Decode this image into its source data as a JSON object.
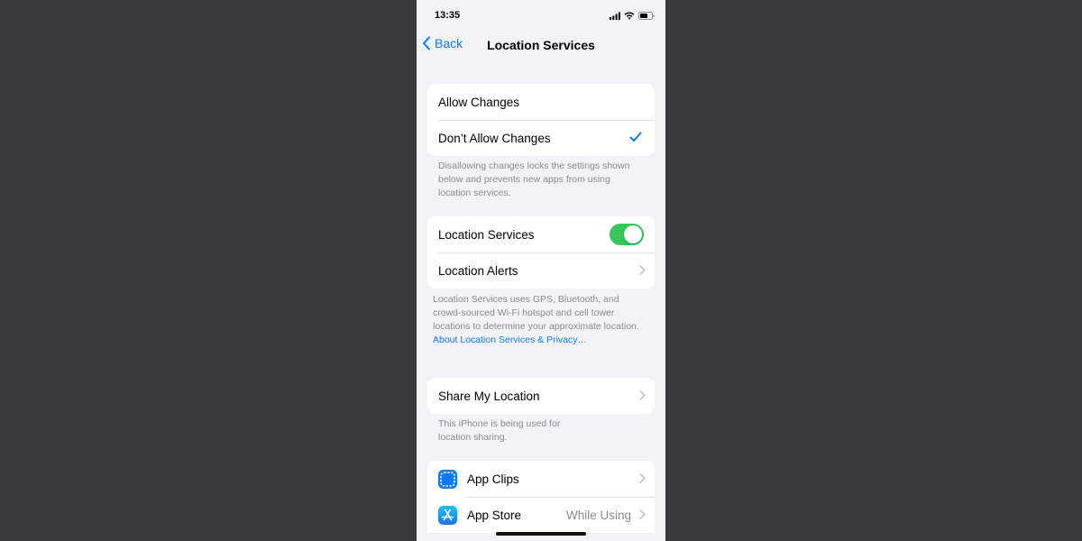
{
  "status_bar": {
    "time": "13:35"
  },
  "nav": {
    "back_label": "Back",
    "title": "Location Services"
  },
  "changes_group": {
    "items": [
      {
        "label": "Allow Changes",
        "selected": false
      },
      {
        "label": "Don’t Allow Changes",
        "selected": true
      }
    ],
    "footer": "Disallowing changes locks the settings shown below and prevents new apps from using location services."
  },
  "location_group": {
    "services_label": "Location Services",
    "services_enabled": true,
    "alerts_label": "Location Alerts",
    "footer": "Location Services uses GPS, Bluetooth, and crowd-sourced Wi-Fi hotspot and cell tower locations to determine your approximate location.",
    "footer_link": "About Location Services & Privacy…"
  },
  "share_group": {
    "label": "Share My Location",
    "footer": "This iPhone is being used for location sharing."
  },
  "apps": [
    {
      "label": "App Clips",
      "value": "",
      "icon": "app-clips-icon"
    },
    {
      "label": "App Store",
      "value": "While Using",
      "icon": "app-store-icon"
    }
  ],
  "colors": {
    "accent": "#0a7aff",
    "toggle_on": "#34c759",
    "background": "#f2f2f7",
    "secondary_text": "#8a8a8e"
  }
}
